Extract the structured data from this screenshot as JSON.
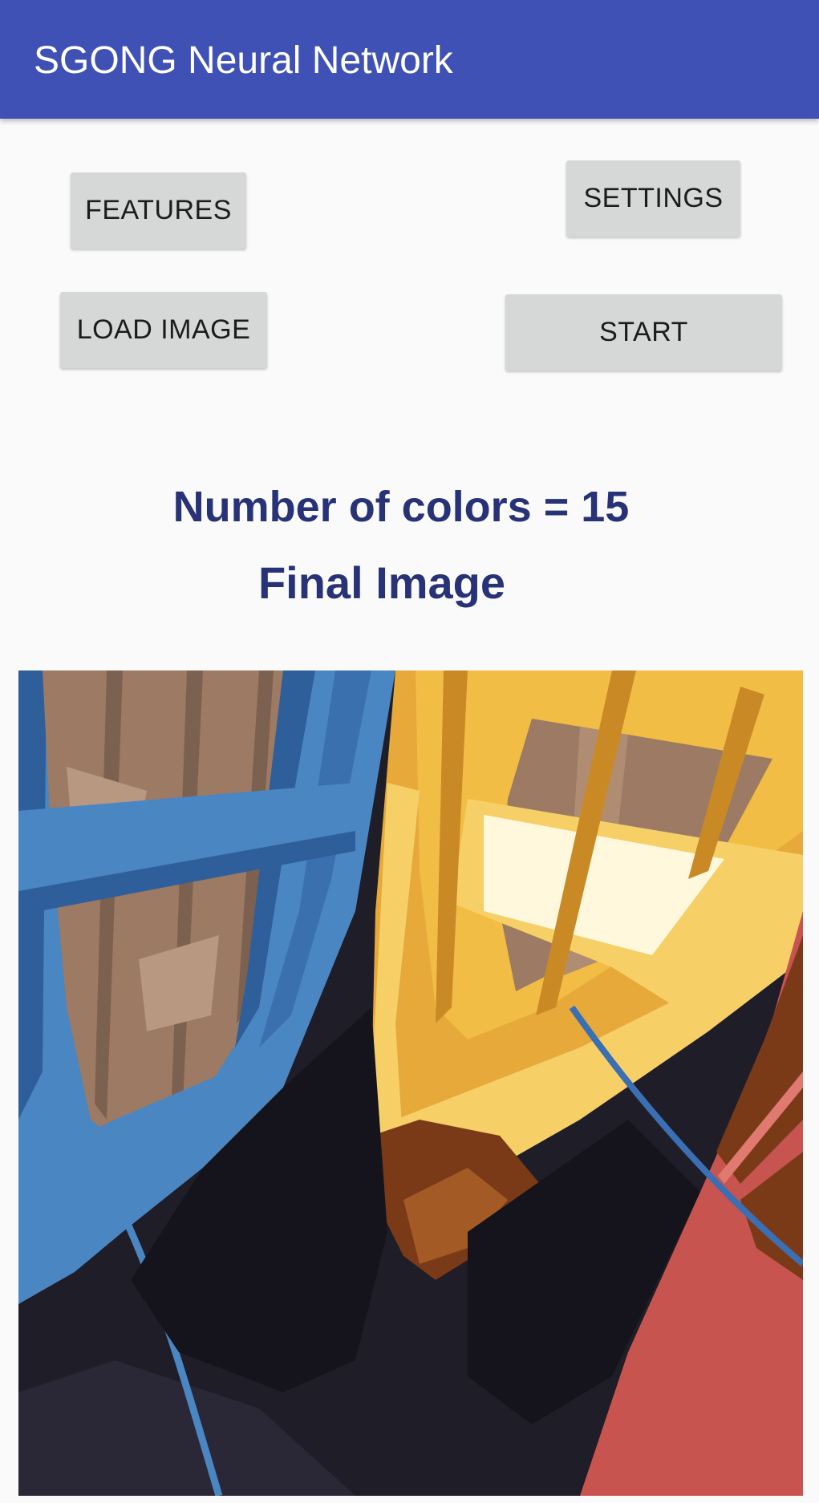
{
  "app_bar": {
    "title": "SGONG Neural Network",
    "color": "#3f51b5"
  },
  "buttons": {
    "features": "FEATURES",
    "settings": "SETTINGS",
    "load_image": "LOAD IMAGE",
    "start": "START"
  },
  "result": {
    "colors_label": "Number of colors = 15",
    "final_title": "Final Image",
    "text_color": "#283276"
  },
  "image": {
    "content": "quantized-boats-photo",
    "palette": [
      "#1f1d28",
      "#4a86c2",
      "#2f5f9a",
      "#9c7a63",
      "#e6a93a",
      "#f6d067",
      "#fff8dc",
      "#c85450",
      "#7a3a18"
    ]
  }
}
